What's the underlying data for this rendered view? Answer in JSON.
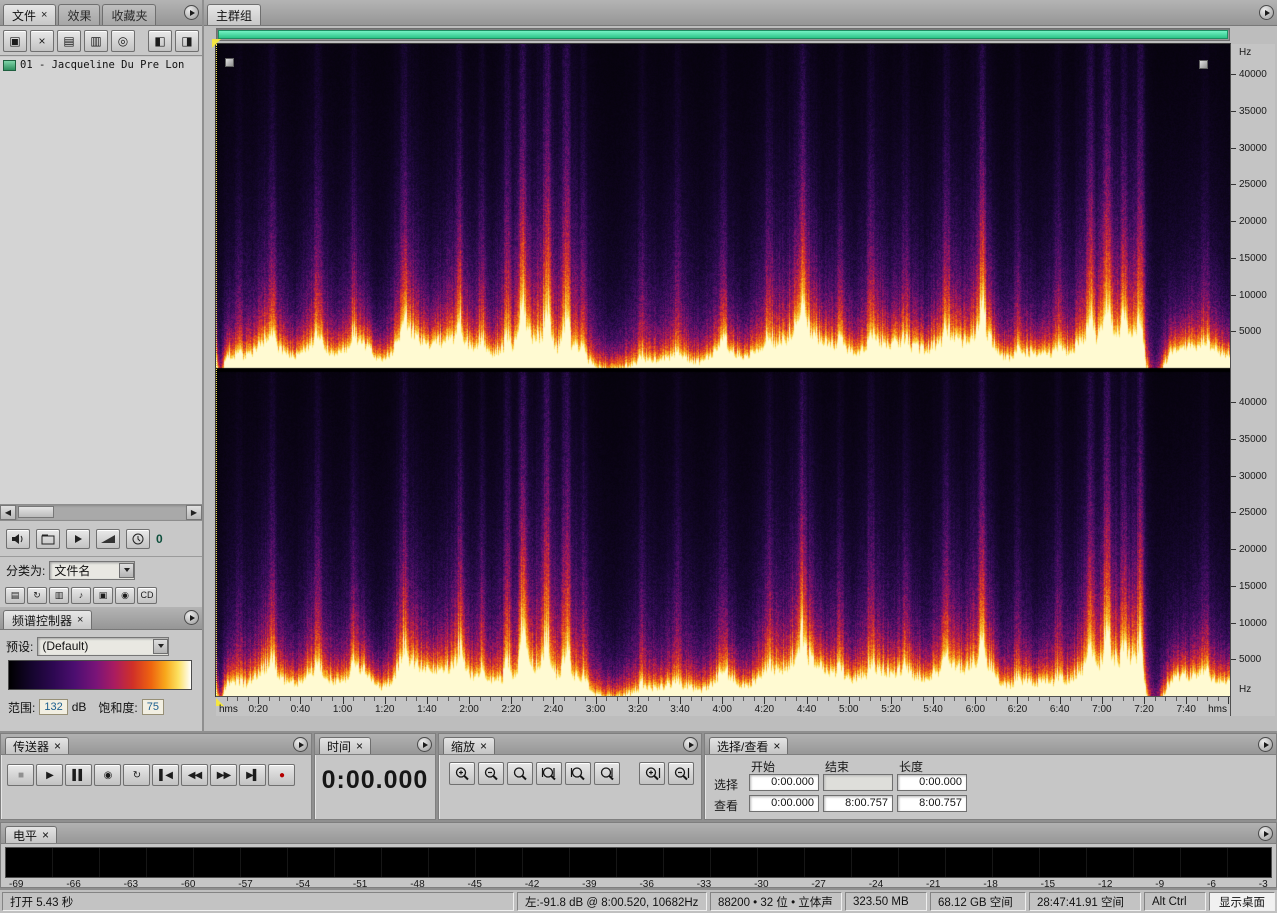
{
  "ui": {
    "close_glyph": "×"
  },
  "files_panel": {
    "tabs": [
      {
        "label": "文件"
      },
      {
        "label": "效果"
      },
      {
        "label": "收藏夹"
      }
    ],
    "toolbar": [
      {
        "name": "import-file-button",
        "glyph": "▣"
      },
      {
        "name": "close-files-button",
        "glyph": "×"
      },
      {
        "name": "edit-file-button",
        "glyph": "▤"
      },
      {
        "name": "insert-into-multitrack-button",
        "glyph": "▥"
      },
      {
        "name": "insert-into-cd-button",
        "glyph": "◎"
      },
      {
        "name": "show-options-left-button",
        "glyph": "◧"
      },
      {
        "name": "show-options-right-button",
        "glyph": "◨"
      }
    ],
    "files": [
      {
        "name": "01 - Jacqueline Du Pre Lon"
      }
    ],
    "sort_label": "分类为:",
    "sort_value": "文件名",
    "preview_volume": "0",
    "toggles": [
      {
        "name": "show-audio-files-toggle",
        "glyph": "▤"
      },
      {
        "name": "show-loop-files-toggle",
        "glyph": "↻"
      },
      {
        "name": "show-video-files-toggle",
        "glyph": "▥"
      },
      {
        "name": "show-midi-files-toggle",
        "glyph": "♪"
      },
      {
        "name": "show-session-files-toggle",
        "glyph": "▣"
      },
      {
        "name": "preview-auto-play-toggle",
        "glyph": "◉"
      },
      {
        "name": "show-cd-list-toggle",
        "glyph": "CD"
      }
    ]
  },
  "spectral_controls": {
    "tab": "频谱控制器",
    "preset_label": "预设:",
    "preset_value": "(Default)",
    "range_label": "范围:",
    "range_value": "132",
    "range_unit": "dB",
    "saturation_label": "饱和度:",
    "saturation_value": "75"
  },
  "main": {
    "tab": "主群组",
    "hz_label": "Hz",
    "hms_label": "hms",
    "freq_labels": [
      "40000",
      "35000",
      "30000",
      "25000",
      "20000",
      "15000",
      "10000",
      "5000"
    ],
    "time_ticks": [
      "0:20",
      "0:40",
      "1:00",
      "1:20",
      "1:40",
      "2:00",
      "2:20",
      "2:40",
      "3:00",
      "3:20",
      "3:40",
      "4:00",
      "4:20",
      "4:40",
      "5:00",
      "5:20",
      "5:40",
      "6:00",
      "6:20",
      "6:40",
      "7:00",
      "7:20",
      "7:40"
    ]
  },
  "transport": {
    "tab": "传送器",
    "buttons": [
      {
        "name": "stop-button",
        "glyph": "■",
        "disabled": true
      },
      {
        "name": "play-button",
        "glyph": "▶"
      },
      {
        "name": "pause-button",
        "glyph": "▌▌"
      },
      {
        "name": "play-from-cursor-button",
        "glyph": "◉"
      },
      {
        "name": "play-looped-button",
        "glyph": "↻"
      },
      {
        "name": "go-to-beginning-button",
        "glyph": "▌◀"
      },
      {
        "name": "rewind-button",
        "glyph": "◀◀"
      },
      {
        "name": "fast-forward-button",
        "glyph": "▶▶"
      },
      {
        "name": "go-to-end-button",
        "glyph": "▶▌"
      },
      {
        "name": "record-button",
        "glyph": "●",
        "color": "#b40000"
      }
    ]
  },
  "time_panel": {
    "tab": "时间",
    "value": "0:00.000"
  },
  "zoom_panel": {
    "tab": "缩放",
    "buttons": [
      {
        "name": "zoom-in-horizontal-button",
        "sym": "+"
      },
      {
        "name": "zoom-out-horizontal-button",
        "sym": "-"
      },
      {
        "name": "zoom-out-full-button",
        "sym": "none"
      },
      {
        "name": "zoom-to-selection-button",
        "sym": "sel"
      },
      {
        "name": "zoom-to-selection-left-button",
        "sym": "selL"
      },
      {
        "name": "zoom-to-selection-right-button",
        "sym": "selR"
      },
      {
        "name": "zoom-in-vertical-button",
        "sym": "v+"
      },
      {
        "name": "zoom-out-vertical-button",
        "sym": "v-"
      }
    ]
  },
  "selection_view": {
    "tab": "选择/查看",
    "columns": [
      "开始",
      "结束",
      "长度"
    ],
    "rows": [
      {
        "label": "选择",
        "start": "0:00.000",
        "end": "",
        "length": "0:00.000"
      },
      {
        "label": "查看",
        "start": "0:00.000",
        "end": "8:00.757",
        "length": "8:00.757"
      }
    ]
  },
  "levels": {
    "tab": "电平",
    "ticks": [
      "-69",
      "-66",
      "-63",
      "-60",
      "-57",
      "-54",
      "-51",
      "-48",
      "-45",
      "-42",
      "-39",
      "-36",
      "-33",
      "-30",
      "-27",
      "-24",
      "-21",
      "-18",
      "-15",
      "-12",
      "-9",
      "-6",
      "-3"
    ]
  },
  "status": {
    "open_info": "打开 5.43 秒",
    "cursor_info": "左:-91.8 dB @  8:00.520, 10682Hz",
    "format_info": "88200 • 32 位 • 立体声",
    "file_size": "323.50 MB",
    "disk_free": "68.12 GB 空间",
    "time_free": "28:47:41.91 空间",
    "modifier_keys": "Alt Ctrl",
    "show_desktop": "显示桌面"
  }
}
